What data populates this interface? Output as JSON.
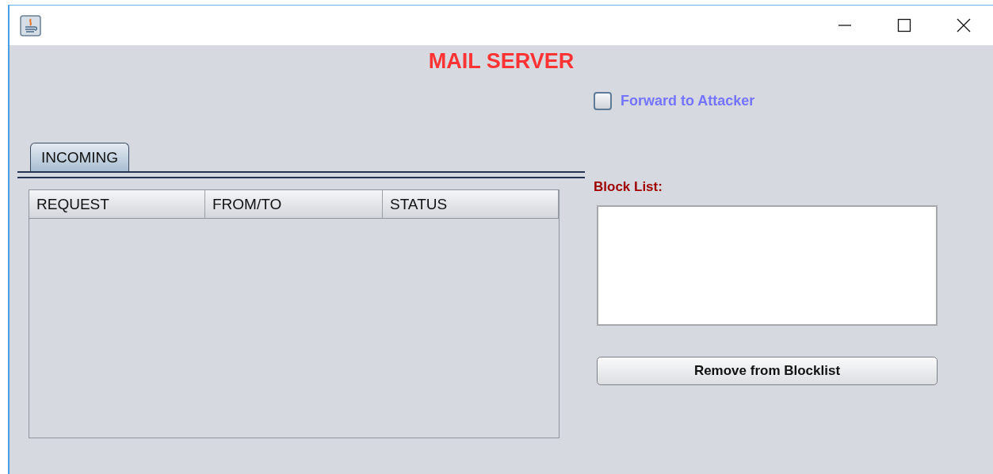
{
  "heading": "MAIL SERVER",
  "tabs": [
    {
      "label": "INCOMING",
      "selected": true
    }
  ],
  "table": {
    "columns": [
      "REQUEST",
      "FROM/TO",
      "STATUS"
    ]
  },
  "forward_checkbox": {
    "label": "Forward to Attacker",
    "checked": false
  },
  "block_list": {
    "label": "Block List:"
  },
  "buttons": [
    {
      "label": "Remove from Blocklist"
    }
  ]
}
